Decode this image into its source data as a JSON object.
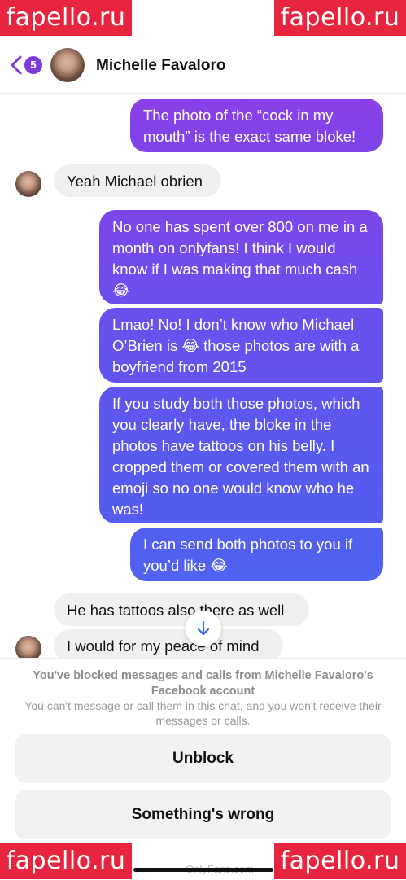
{
  "watermark": {
    "text": "fapello.ru",
    "color": "#e8253f"
  },
  "header": {
    "back_badge_count": "5",
    "contact_name": "Michelle Favaloro"
  },
  "messages": [
    {
      "direction": "outgoing",
      "text": "The photo of the “cock in my mouth” is the exact same bloke!"
    },
    {
      "direction": "incoming",
      "text": "Yeah Michael obrien"
    },
    {
      "direction": "outgoing",
      "text": "No one has spent over 800 on me in a month on onlyfans! I think I would know if I was making that much cash 😂"
    },
    {
      "direction": "outgoing",
      "text": "Lmao! No! I don’t know who Michael O’Brien is 😂 those photos are with a boyfriend from 2015"
    },
    {
      "direction": "outgoing",
      "text": "If you study both those photos, which you clearly have, the bloke in the photos have tattoos on his belly. I cropped them or covered them with an emoji so no one would know who he was!"
    },
    {
      "direction": "outgoing",
      "text": "I can send both photos to you if you’d like 😂"
    },
    {
      "direction": "incoming",
      "text": "He has tattoos also there as well"
    },
    {
      "direction": "incoming",
      "text": "I would for my peace of mind"
    }
  ],
  "blocked": {
    "title": "You've blocked messages and calls from Michelle Favaloro's Facebook account",
    "subtitle": "You can't message or call them in this chat, and you won't receive their messages or calls.",
    "unblock_label": "Unblock",
    "wrong_label": "Something's wrong"
  },
  "footer": {
    "mark": "OnlyFans.com"
  },
  "colors": {
    "accent": "#7d3bdf",
    "outgoing_top": "#8b3fe6",
    "outgoing_bottom": "#4f62f0",
    "incoming": "#f0f0f0"
  }
}
